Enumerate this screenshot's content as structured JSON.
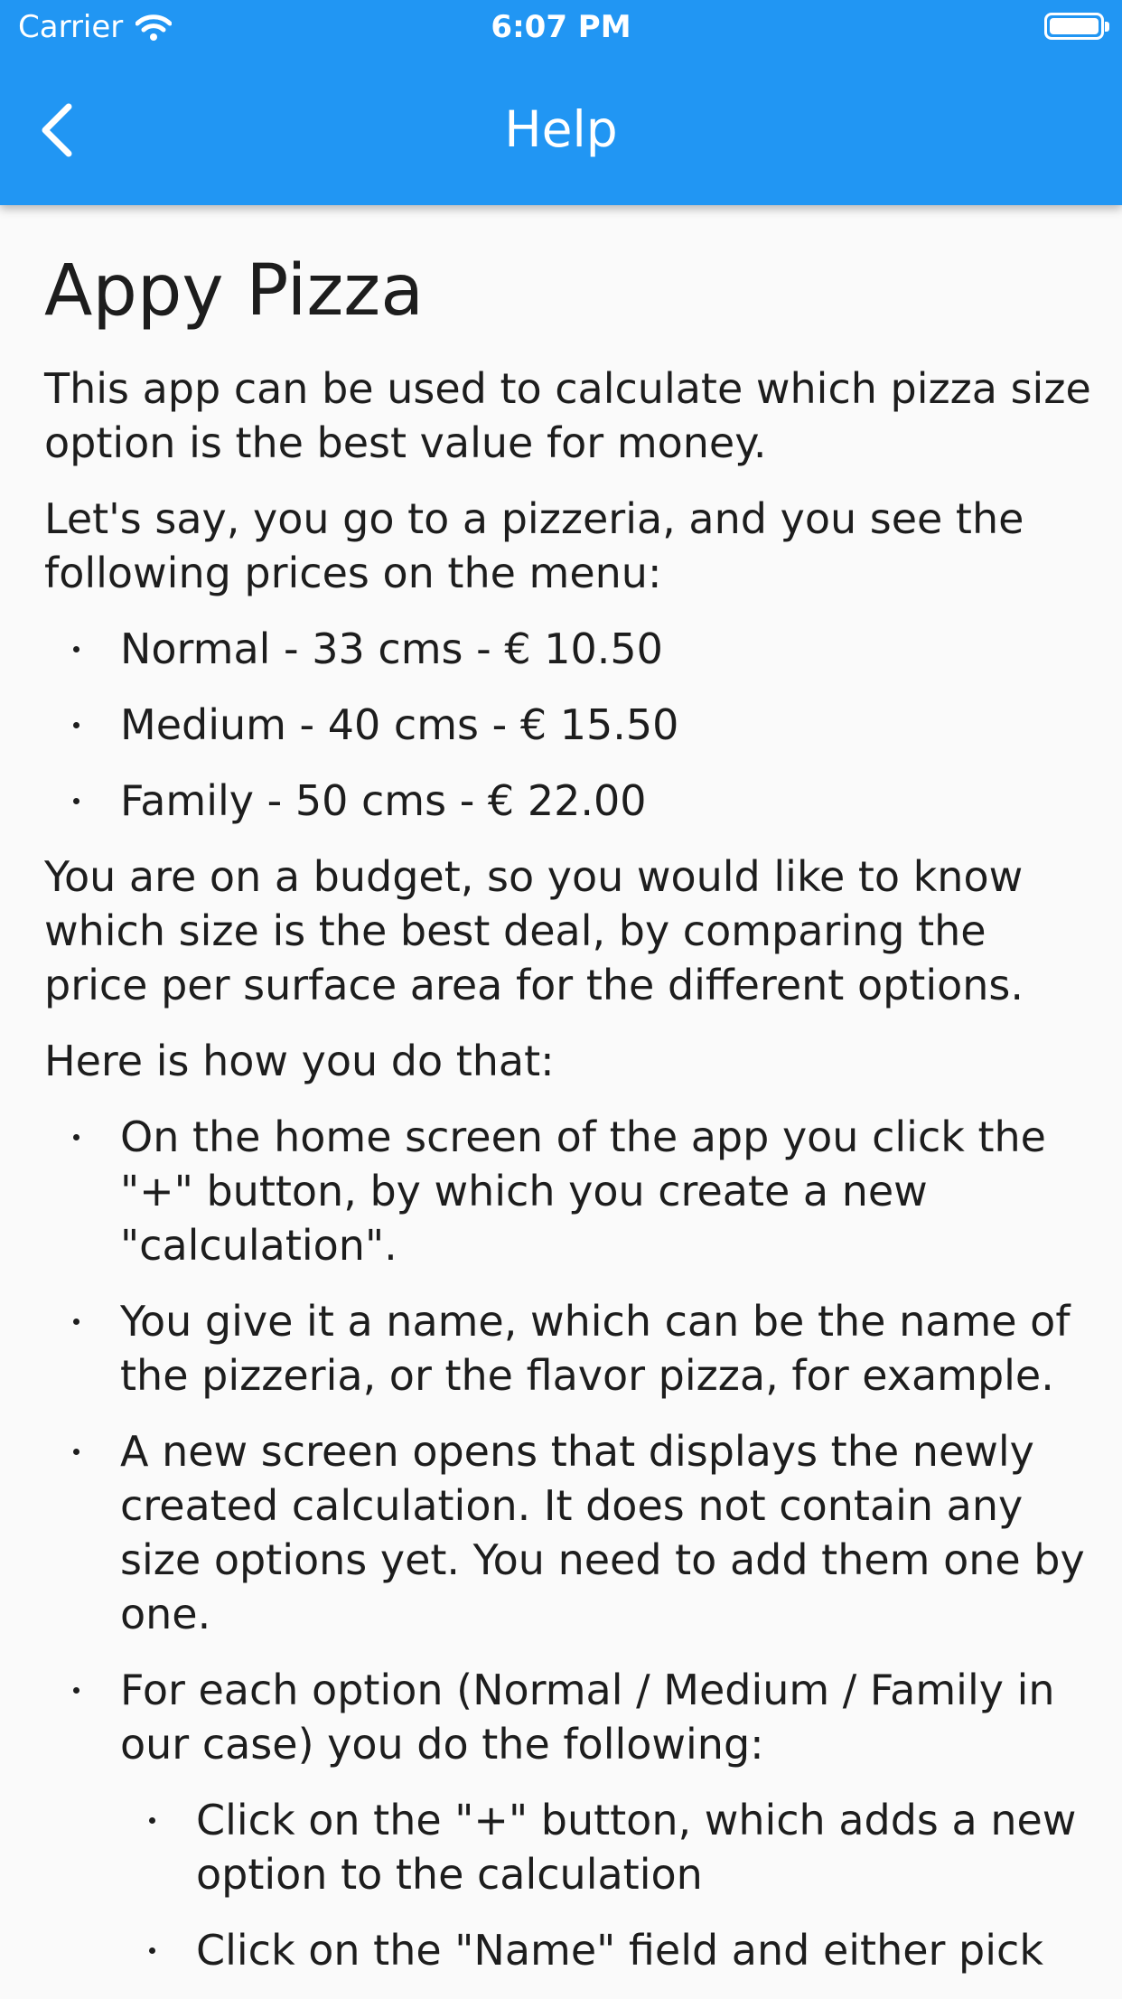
{
  "status_bar": {
    "carrier": "Carrier",
    "time": "6:07 PM"
  },
  "app_bar": {
    "title": "Help",
    "color": "#2196f3"
  },
  "content": {
    "heading": "Appy Pizza",
    "intro": "This app can be used to calculate which pizza size option is the best value for money.",
    "scenario": "Let's say, you go to a pizzeria, and you see the following prices on the menu:",
    "menu_items": [
      "Normal - 33 cms - € 10.50",
      "Medium - 40 cms - € 15.50",
      "Family - 50 cms - € 22.00"
    ],
    "budget": "You are on a budget, so you would like to know which size is the best deal, by comparing the price per surface area for the different options.",
    "howto_intro": "Here is how you do that:",
    "steps": [
      "On the home screen of the app you click the \"+\" button, by which you create a new \"calculation\".",
      "You give it a name, which can be the name of the pizzeria, or the flavor pizza, for example.",
      "A new screen opens that displays the newly created calculation. It does not contain any size options yet. You need to add them one by one.",
      "For each option (Normal / Medium / Family in our case) you do the following:"
    ],
    "substeps": [
      "Click on the \"+\" button, which adds a new option to the calculation",
      "Click on the \"Name\" field and either pick"
    ]
  }
}
